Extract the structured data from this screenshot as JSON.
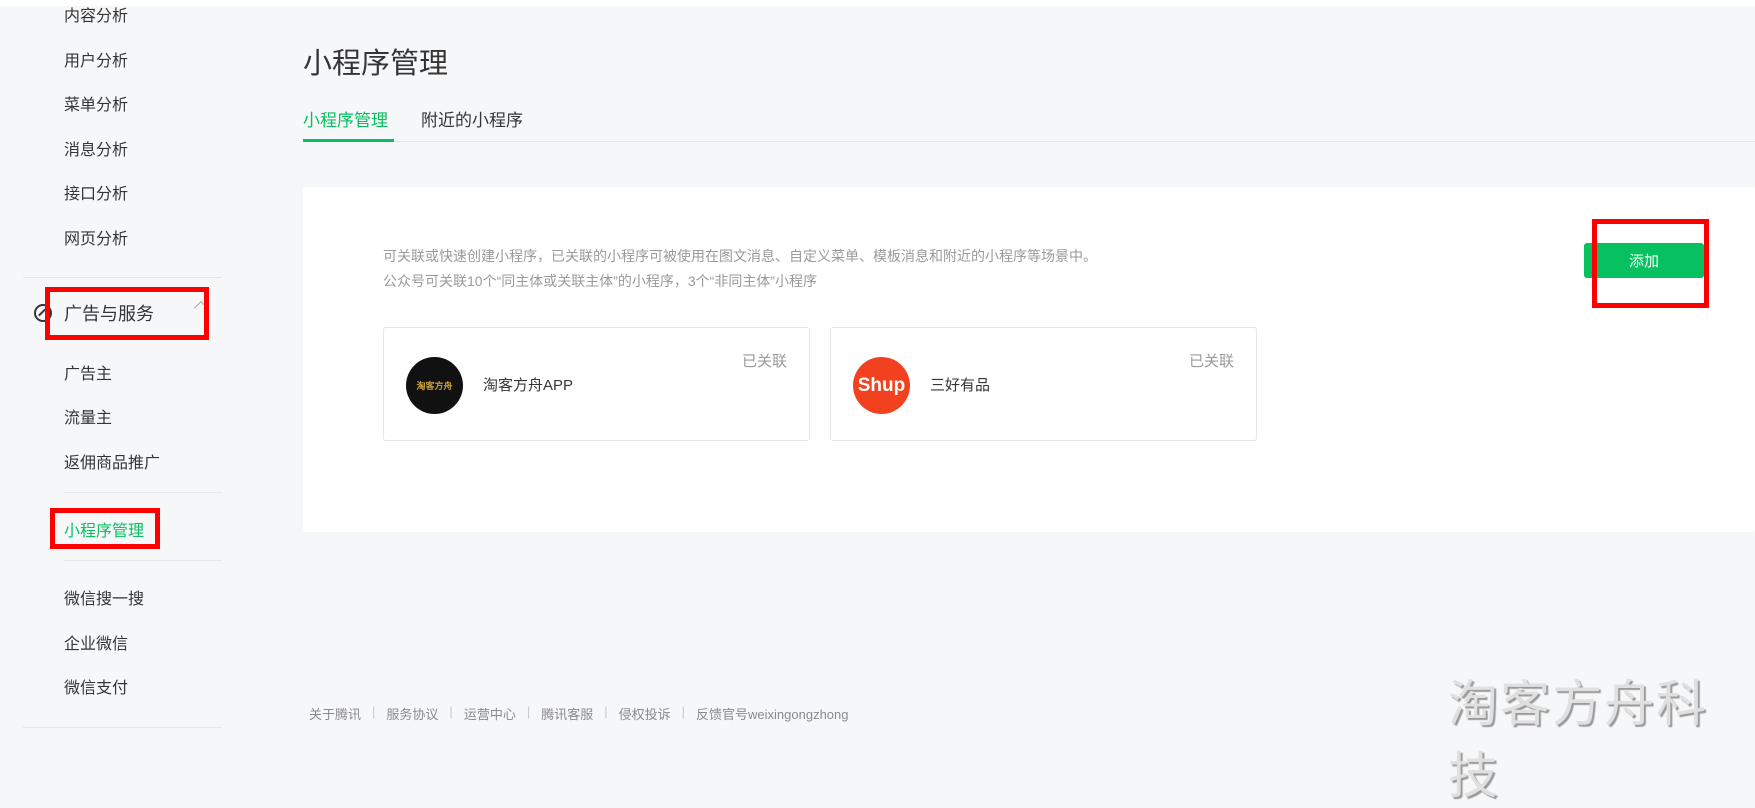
{
  "sidebar": {
    "analysis_items": [
      "内容分析",
      "用户分析",
      "菜单分析",
      "消息分析",
      "接口分析",
      "网页分析"
    ],
    "section_title": "广告与服务",
    "section_items": [
      "广告主",
      "流量主",
      "返佣商品推广"
    ],
    "active_item": "小程序管理",
    "other_items": [
      "微信搜一搜",
      "企业微信",
      "微信支付"
    ]
  },
  "header": {
    "title": "小程序管理"
  },
  "tabs": [
    {
      "label": "小程序管理",
      "active": true
    },
    {
      "label": "附近的小程序",
      "active": false
    }
  ],
  "panel": {
    "desc_line1": "可关联或快速创建小程序，已关联的小程序可被使用在图文消息、自定义菜单、模板消息和附近的小程序等场景中。",
    "desc_line2": "公众号可关联10个“同主体或关联主体”的小程序，3个“非同主体”小程序",
    "add_label": "添加",
    "mini_programs": [
      {
        "name": "淘客方舟APP",
        "status": "已关联",
        "logo_text": "淘客方舟"
      },
      {
        "name": "三好有品",
        "status": "已关联",
        "logo_text": "Shup"
      }
    ]
  },
  "footer": {
    "links": [
      "关于腾讯",
      "服务协议",
      "运营中心",
      "腾讯客服",
      "侵权投诉",
      "反馈官号weixingongzhong"
    ]
  },
  "watermark": "淘客方舟科技",
  "colors": {
    "accent": "#07c160",
    "highlight": "#ff0000"
  }
}
